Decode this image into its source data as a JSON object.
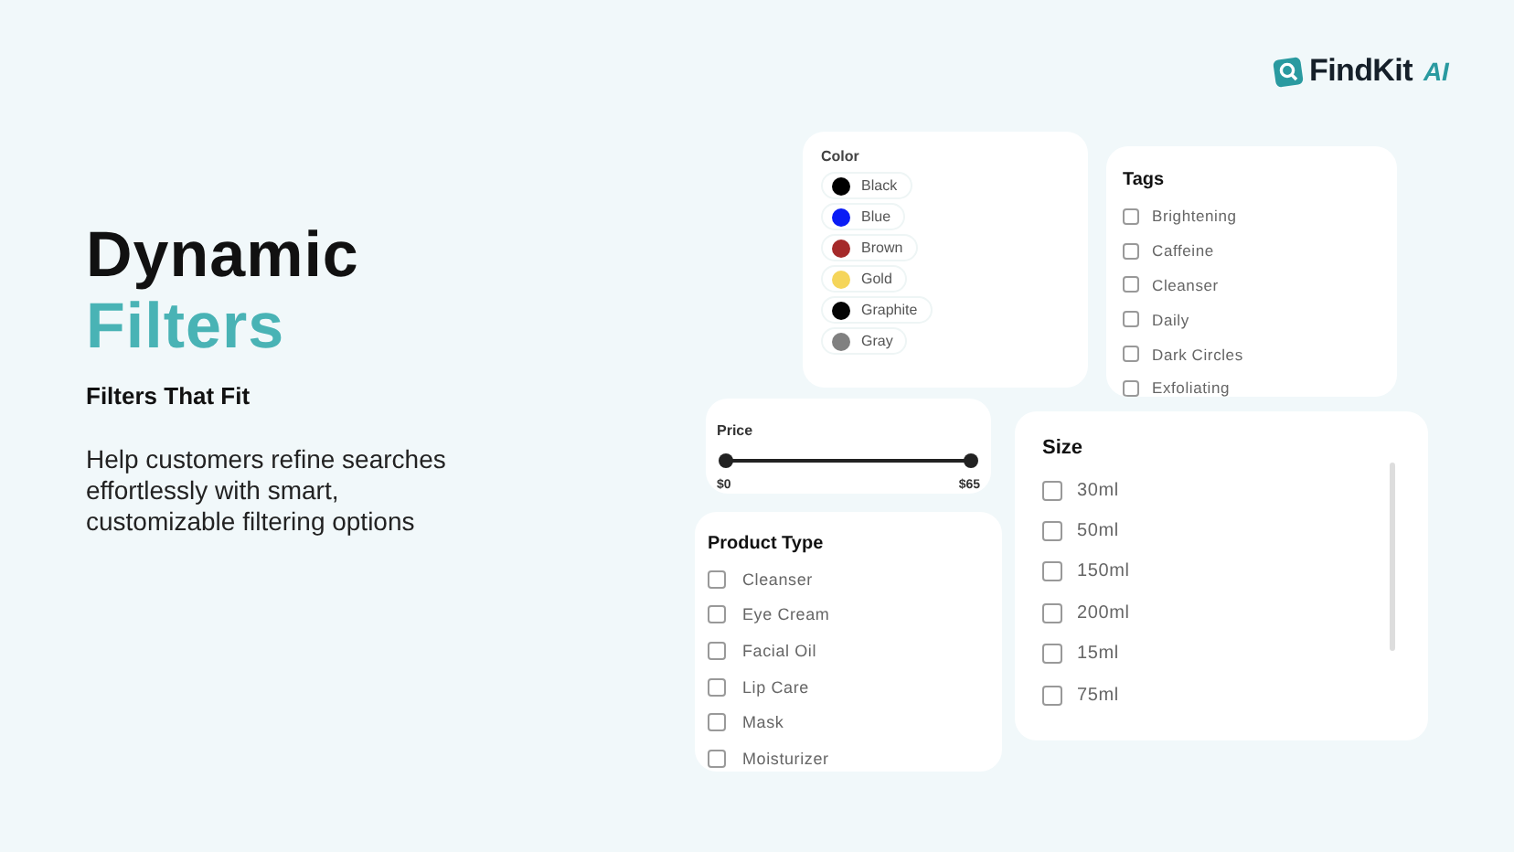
{
  "logo": {
    "name": "FindKit",
    "suffix": "AI"
  },
  "hero": {
    "title_line_1": "Dynamic",
    "title_line_2": "Filters",
    "subtitle": "Filters That Fit",
    "description": "Help customers refine searches effortlessly with smart, customizable filtering options"
  },
  "color_filter": {
    "title": "Color",
    "options": [
      {
        "label": "Black",
        "color": "#000000"
      },
      {
        "label": "Blue",
        "color": "#0a1cf5"
      },
      {
        "label": "Brown",
        "color": "#a52a2a"
      },
      {
        "label": "Gold",
        "color": "#f5d55a"
      },
      {
        "label": "Graphite",
        "color": "#050505"
      },
      {
        "label": "Gray",
        "color": "#808080"
      }
    ]
  },
  "tags_filter": {
    "title": "Tags",
    "options": [
      {
        "label": "Brightening",
        "checked": false
      },
      {
        "label": "Caffeine",
        "checked": false
      },
      {
        "label": "Cleanser",
        "checked": false
      },
      {
        "label": "Daily",
        "checked": false
      },
      {
        "label": "Dark Circles",
        "checked": false
      },
      {
        "label": "Exfoliating",
        "checked": false
      }
    ]
  },
  "price_filter": {
    "title": "Price",
    "min_label": "$0",
    "max_label": "$65",
    "thumbs": [
      {
        "level": 0
      },
      {
        "level": 1
      }
    ]
  },
  "product_type_filter": {
    "title": "Product Type",
    "options": [
      {
        "label": "Cleanser",
        "checked": false
      },
      {
        "label": "Eye Cream",
        "checked": false
      },
      {
        "label": "Facial Oil",
        "checked": false
      },
      {
        "label": "Lip Care",
        "checked": false
      },
      {
        "label": "Mask",
        "checked": false
      },
      {
        "label": "Moisturizer",
        "checked": false
      }
    ]
  },
  "size_filter": {
    "title": "Size",
    "options": [
      {
        "label": "30ml",
        "checked": false
      },
      {
        "label": "50ml",
        "checked": false
      },
      {
        "label": "150ml",
        "checked": false
      },
      {
        "label": "200ml",
        "checked": false
      },
      {
        "label": "15ml",
        "checked": false
      },
      {
        "label": "75ml",
        "checked": false
      }
    ]
  }
}
